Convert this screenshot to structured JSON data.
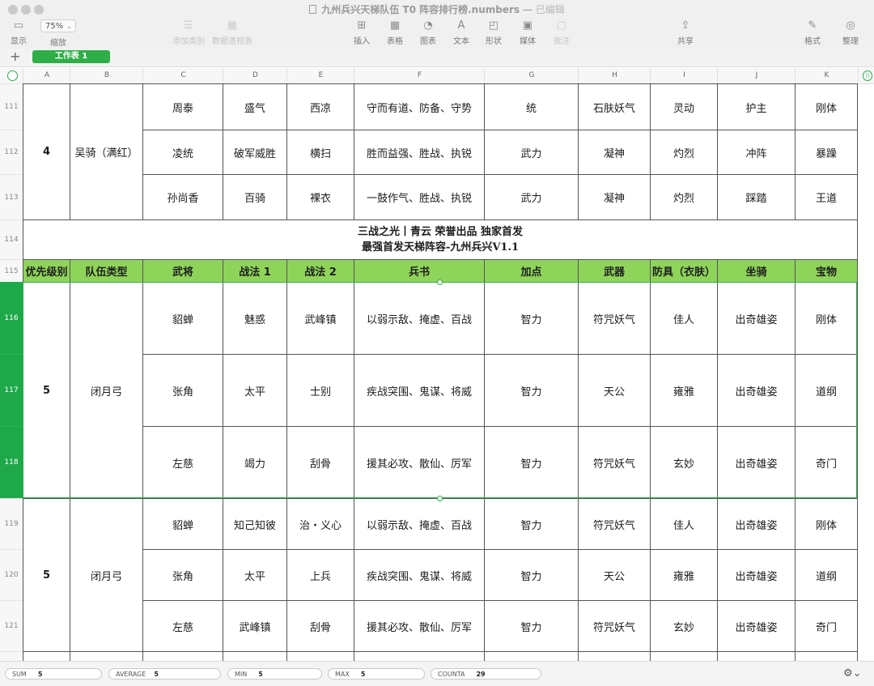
{
  "window": {
    "filename": "九州兵兴天梯队伍 T0 阵容排行榜.numbers",
    "separator": "—",
    "status": "已编辑"
  },
  "toolbar": {
    "display": "显示",
    "zoom_value": "75%",
    "zoom_label": "缩放",
    "add_category": "添加类别",
    "pivot_table": "数据透视表",
    "insert": "插入",
    "table": "表格",
    "chart": "图表",
    "text": "文本",
    "shape": "形状",
    "media": "媒体",
    "comment": "批注",
    "share": "共享",
    "format": "格式",
    "organize": "整理"
  },
  "sheet": {
    "add": "+",
    "tab_label": "工作表 1"
  },
  "columns": [
    "A",
    "B",
    "C",
    "D",
    "E",
    "F",
    "G",
    "H",
    "I",
    "J",
    "K"
  ],
  "rows_top": {
    "numbers": [
      "111",
      "112",
      "113"
    ],
    "priority": "4",
    "team_type": "吴骑（满红）",
    "members": [
      [
        "周泰",
        "盛气",
        "西凉",
        "守而有道、防备、守势",
        "统",
        "石肤妖气",
        "灵动",
        "护主",
        "刚体"
      ],
      [
        "凌统",
        "破军威胜",
        "横扫",
        "胜而益强、胜战、执锐",
        "武力",
        "凝神",
        "灼烈",
        "冲阵",
        "暴躁"
      ],
      [
        "孙尚香",
        "百骑",
        "裸衣",
        "一鼓作气、胜战、执锐",
        "武力",
        "凝神",
        "灼烈",
        "踩踏",
        "王道"
      ]
    ]
  },
  "banner": {
    "row": "114",
    "line1": "三战之光丨青云 荣誉出品 独家首发",
    "line2": "最强首发天梯阵容-九州兵兴V1.1"
  },
  "header": {
    "row": "115",
    "cells": [
      "优先级别",
      "队伍类型",
      "武将",
      "战法 1",
      "战法 2",
      "兵书",
      "加点",
      "武器",
      "防具（衣肤）",
      "坐骑",
      "宝物"
    ]
  },
  "group1": {
    "numbers": [
      "116",
      "117",
      "118"
    ],
    "priority": "5",
    "team_type": "闭月弓",
    "members": [
      [
        "貂蝉",
        "魅惑",
        "武峰镇",
        "以弱示敌、掩虚、百战",
        "智力",
        "符咒妖气",
        "佳人",
        "出奇雄姿",
        "刚体"
      ],
      [
        "张角",
        "太平",
        "士别",
        "疾战突围、鬼谋、将威",
        "智力",
        "天公",
        "雍雅",
        "出奇雄姿",
        "道纲"
      ],
      [
        "左慈",
        "竭力",
        "刮骨",
        "援其必攻、散仙、厉军",
        "智力",
        "符咒妖气",
        "玄妙",
        "出奇雄姿",
        "奇门"
      ]
    ]
  },
  "group2": {
    "numbers": [
      "119",
      "120",
      "121"
    ],
    "priority": "5",
    "team_type": "闭月弓",
    "members": [
      [
        "貂蝉",
        "知己知彼",
        "治・义心",
        "以弱示敌、掩虚、百战",
        "智力",
        "符咒妖气",
        "佳人",
        "出奇雄姿",
        "刚体"
      ],
      [
        "张角",
        "太平",
        "上兵",
        "疾战突围、鬼谋、将威",
        "智力",
        "天公",
        "雍雅",
        "出奇雄姿",
        "道纲"
      ],
      [
        "左慈",
        "武峰镇",
        "刮骨",
        "援其必攻、散仙、厉军",
        "智力",
        "符咒妖气",
        "玄妙",
        "出奇雄姿",
        "奇门"
      ]
    ]
  },
  "statusbar": {
    "sum_label": "SUM",
    "sum_value": "5",
    "avg_label": "AVERAGE",
    "avg_value": "5",
    "min_label": "MIN",
    "min_value": "5",
    "max_label": "MAX",
    "max_value": "5",
    "counta_label": "COUNTA",
    "counta_value": "29"
  },
  "colors": {
    "header_fill": "#8fd45a",
    "selection": "#2fae48",
    "tab": "#2fae48"
  }
}
